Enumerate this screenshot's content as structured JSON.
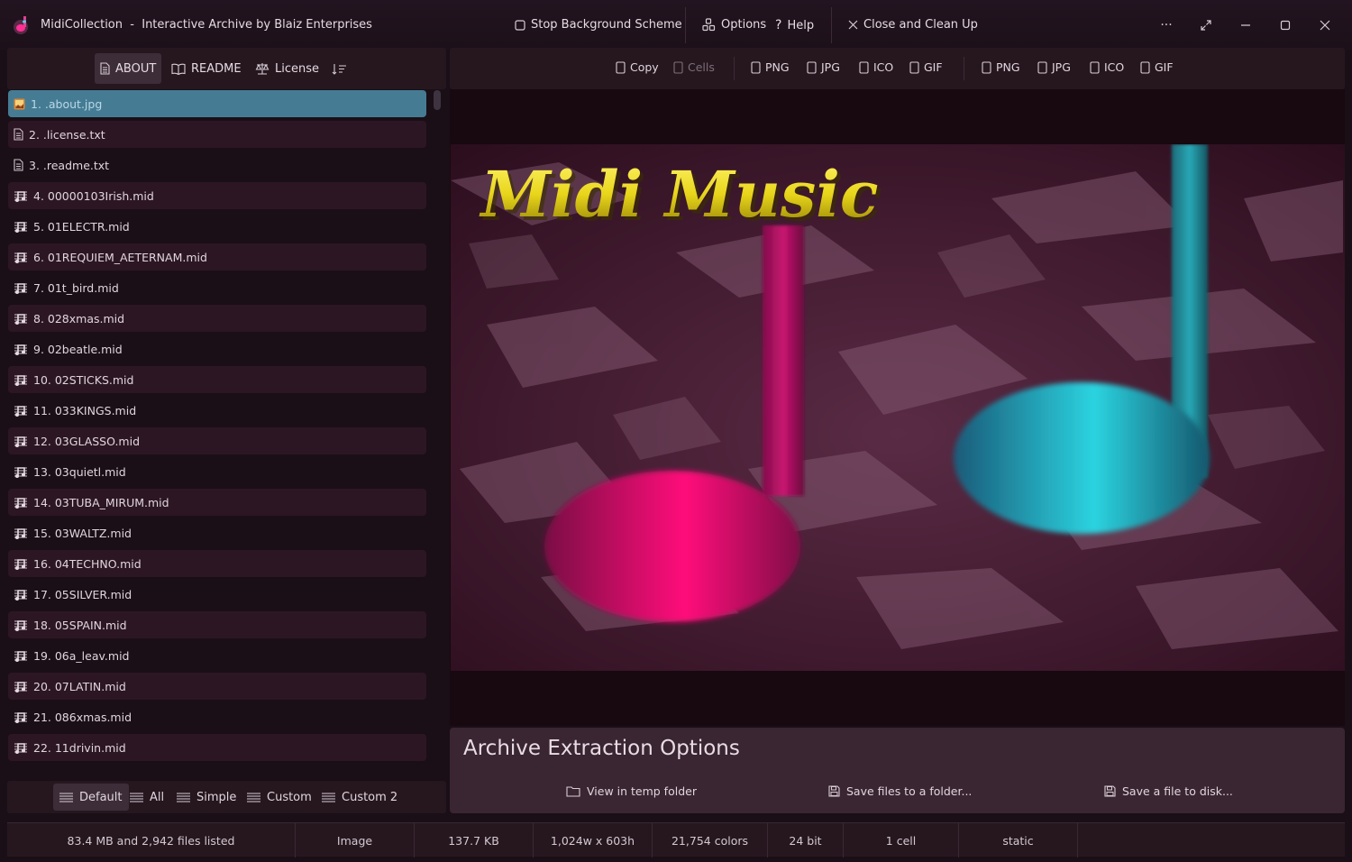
{
  "window": {
    "app_name": "MidiCollection",
    "subtitle": "Interactive Archive by Blaiz Enterprises",
    "stop_bg_label": "Stop Background Scheme",
    "options_label": "Options",
    "help_label": "Help",
    "close_label": "Close and Clean Up"
  },
  "left_tabs": {
    "about": "ABOUT",
    "readme": "README",
    "license": "License"
  },
  "files": [
    {
      "label": "1.  .about.jpg",
      "type": "image"
    },
    {
      "label": "2.  .license.txt",
      "type": "text"
    },
    {
      "label": "3.  .readme.txt",
      "type": "text"
    },
    {
      "label": "4.  00000103Irish.mid",
      "type": "midi"
    },
    {
      "label": "5.  01ELECTR.mid",
      "type": "midi"
    },
    {
      "label": "6.  01REQUIEM_AETERNAM.mid",
      "type": "midi"
    },
    {
      "label": "7.  01t_bird.mid",
      "type": "midi"
    },
    {
      "label": "8.  028xmas.mid",
      "type": "midi"
    },
    {
      "label": "9.  02beatle.mid",
      "type": "midi"
    },
    {
      "label": "10.  02STICKS.mid",
      "type": "midi"
    },
    {
      "label": "11.  033KINGS.mid",
      "type": "midi"
    },
    {
      "label": "12.  03GLASSO.mid",
      "type": "midi"
    },
    {
      "label": "13.  03quietl.mid",
      "type": "midi"
    },
    {
      "label": "14.  03TUBA_MIRUM.mid",
      "type": "midi"
    },
    {
      "label": "15.  03WALTZ.mid",
      "type": "midi"
    },
    {
      "label": "16.  04TECHNO.mid",
      "type": "midi"
    },
    {
      "label": "17.  05SILVER.mid",
      "type": "midi"
    },
    {
      "label": "18.  05SPAIN.mid",
      "type": "midi"
    },
    {
      "label": "19.  06a_leav.mid",
      "type": "midi"
    },
    {
      "label": "20.  07LATIN.mid",
      "type": "midi"
    },
    {
      "label": "21.  086xmas.mid",
      "type": "midi"
    },
    {
      "label": "22.  11drivin.mid",
      "type": "midi"
    }
  ],
  "view_modes": {
    "default": "Default",
    "all": "All",
    "simple": "Simple",
    "custom": "Custom",
    "custom2": "Custom 2"
  },
  "image_toolbar": {
    "copy": "Copy",
    "cells": "Cells",
    "group1": [
      "PNG",
      "JPG",
      "ICO",
      "GIF"
    ],
    "group2": [
      "PNG",
      "JPG",
      "ICO",
      "GIF"
    ]
  },
  "preview": {
    "banner_text": "Midi Music"
  },
  "extraction": {
    "title": "Archive Extraction Options",
    "view_temp": "View in temp folder",
    "save_folder": "Save files to a folder...",
    "save_disk": "Save a file to disk..."
  },
  "status": {
    "summary": "83.4 MB and 2,942 files listed",
    "kind": "Image",
    "size": "137.7 KB",
    "dimensions": "1,024w x 603h",
    "colors": "21,754 colors",
    "depth": "24 bit",
    "cells": "1 cell",
    "mode": "static"
  },
  "colors": {
    "selection": "#457c94",
    "pink_note": "#ff0a7a",
    "cyan_note": "#2bd3e0",
    "banner_yellow": "#f0e020"
  }
}
